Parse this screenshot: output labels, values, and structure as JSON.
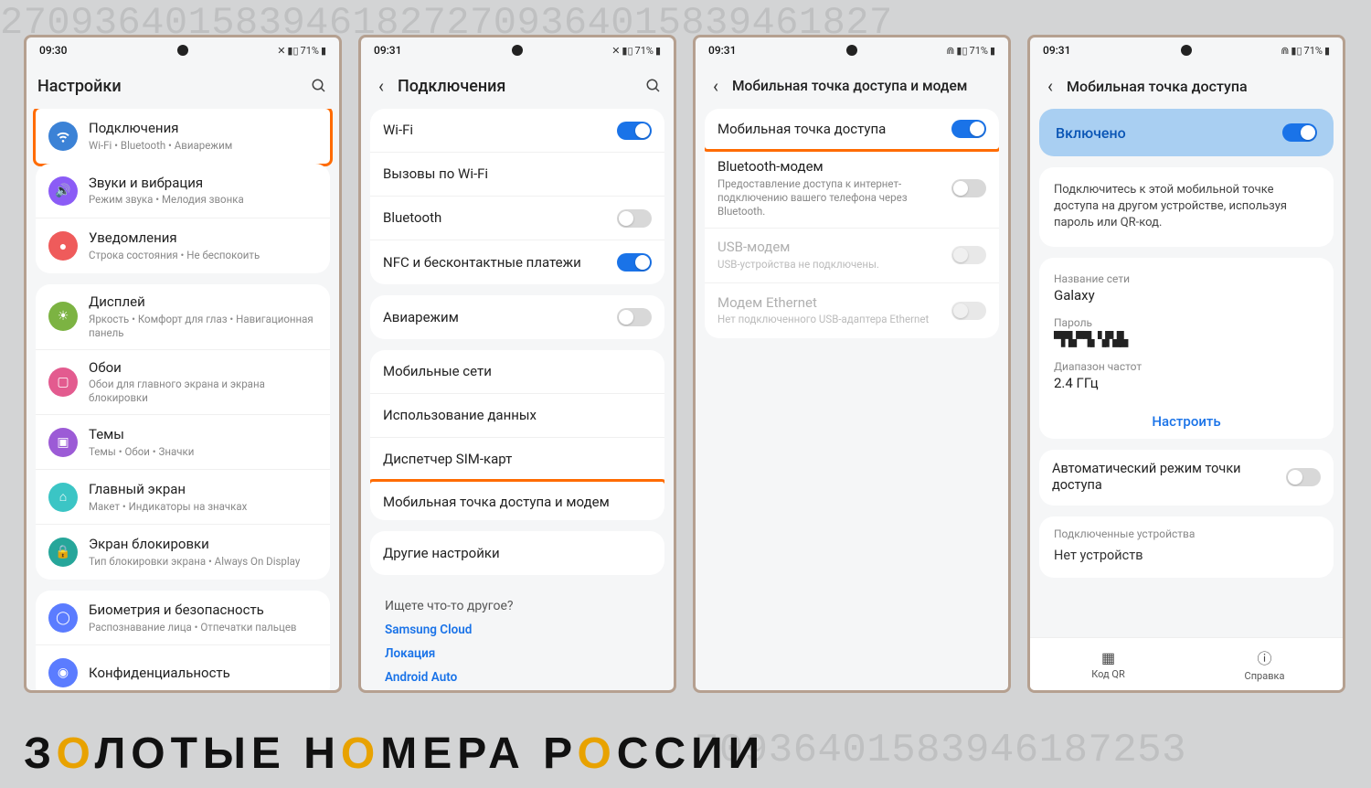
{
  "status": {
    "times": [
      "09:30",
      "09:31",
      "09:31",
      "09:31"
    ],
    "battery_text": "71%"
  },
  "screen1": {
    "title": "Настройки",
    "items": [
      {
        "title": "Подключения",
        "sub": "Wi-Fi • Bluetooth • Авиарежим",
        "color": "#3b82d6"
      },
      {
        "title": "Звуки и вибрация",
        "sub": "Режим звука • Мелодия звонка",
        "color": "#8b5cf6"
      },
      {
        "title": "Уведомления",
        "sub": "Строка состояния • Не беспокоить",
        "color": "#ef5b5b"
      },
      {
        "title": "Дисплей",
        "sub": "Яркость • Комфорт для глаз • Навигационная панель",
        "color": "#7cb342"
      },
      {
        "title": "Обои",
        "sub": "Обои для главного экрана и экрана блокировки",
        "color": "#e35b8f"
      },
      {
        "title": "Темы",
        "sub": "Темы • Обои • Значки",
        "color": "#9c5bd6"
      },
      {
        "title": "Главный экран",
        "sub": "Макет • Индикаторы на значках",
        "color": "#3bc5c5"
      },
      {
        "title": "Экран блокировки",
        "sub": "Тип блокировки экрана • Always On Display",
        "color": "#26a69a"
      },
      {
        "title": "Биометрия и безопасность",
        "sub": "Распознавание лица • Отпечатки пальцев",
        "color": "#5b7cff"
      },
      {
        "title": "Конфиденциальность",
        "sub": "",
        "color": "#5b7cff"
      }
    ]
  },
  "screen2": {
    "title": "Подключения",
    "group1": [
      {
        "title": "Wi-Fi",
        "toggle": true
      },
      {
        "title": "Вызовы по Wi-Fi"
      },
      {
        "title": "Bluetooth",
        "toggle": false
      },
      {
        "title": "NFC и бесконтактные платежи",
        "toggle": true
      }
    ],
    "group2": [
      {
        "title": "Авиарежим",
        "toggle": false
      }
    ],
    "group3": [
      {
        "title": "Мобильные сети"
      },
      {
        "title": "Использование данных"
      },
      {
        "title": "Диспетчер SIM-карт"
      },
      {
        "title": "Мобильная точка доступа и модем",
        "highlighted": true
      }
    ],
    "group4": [
      {
        "title": "Другие настройки"
      }
    ],
    "looking": {
      "q": "Ищете что-то другое?",
      "links": [
        "Samsung Cloud",
        "Локация",
        "Android Auto"
      ]
    }
  },
  "screen3": {
    "title": "Мобильная точка доступа и модем",
    "items": [
      {
        "title": "Мобильная точка доступа",
        "toggle": true,
        "highlighted": true
      },
      {
        "title": "Bluetooth-модем",
        "sub": "Предоставление доступа к интернет-подключению вашего телефона через Bluetooth.",
        "toggle": false
      },
      {
        "title": "USB-модем",
        "sub": "USB-устройства не подключены.",
        "toggle": false,
        "disabled": true
      },
      {
        "title": "Модем Ethernet",
        "sub": "Нет подключенного USB-адаптера Ethernet",
        "toggle": false,
        "disabled": true
      }
    ]
  },
  "screen4": {
    "title": "Мобильная точка доступа",
    "enabled_label": "Включено",
    "desc": "Подключитесь к этой мобильной точке доступа на другом устройстве, используя пароль или QR-код.",
    "network_name_label": "Название сети",
    "network_name": "Galaxy",
    "password_label": "Пароль",
    "password_masked": "▀▛▙▀▜▖▚▛▟▙",
    "band_label": "Диапазон частот",
    "band": "2.4 ГГц",
    "configure": "Настроить",
    "auto_mode": "Автоматический режим точки доступа",
    "connected_label": "Подключенные устройства",
    "no_devices": "Нет устройств",
    "qr_label": "Код QR",
    "help_label": "Справка"
  },
  "watermark": {
    "pre": "З",
    "o1": "О",
    "mid1": "ЛОТЫЕ Н",
    "o2": "О",
    "mid2": "МЕРА Р",
    "o3": "О",
    "tail": "ССИИ"
  },
  "bg_top": "27093640158394618272709364015839461827",
  "bg_bottom": "70936401583946187253"
}
